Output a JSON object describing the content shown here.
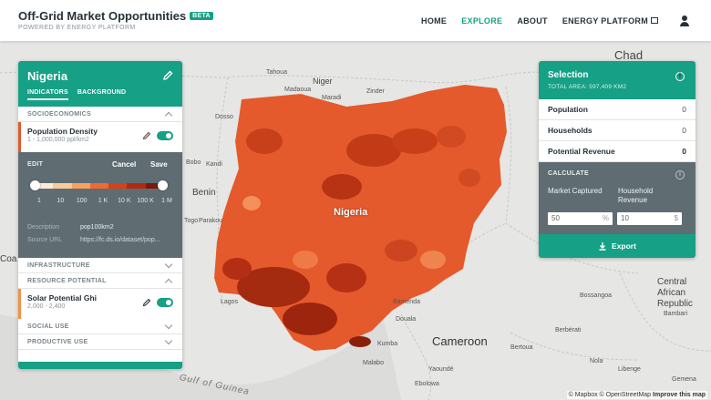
{
  "app": {
    "title": "Off-Grid Market Opportunities",
    "badge": "BETA",
    "subtitle": "POWERED BY ENERGY PLATFORM"
  },
  "nav": {
    "home": "HOME",
    "explore": "EXPLORE",
    "about": "ABOUT",
    "energy_platform": "ENERGY PLATFORM"
  },
  "panel": {
    "title": "Nigeria",
    "tabs": [
      "INDICATORS",
      "BACKGROUND"
    ],
    "sections": {
      "socioeconomics": "SOCIOECONOMICS",
      "infrastructure": "INFRASTRUCTURE",
      "resource_potential": "RESOURCE POTENTIAL",
      "social_use": "SOCIAL USE",
      "productive_use": "PRODUCTIVE USE"
    },
    "population": {
      "name": "Population Density",
      "range": "1 - 1,000,000 ppl/km2",
      "enabled": true,
      "edit_label": "EDIT",
      "cancel": "Cancel",
      "save": "Save",
      "ticks": [
        "1",
        "10",
        "100",
        "1 K",
        "10 K",
        "100 K",
        "1 M"
      ],
      "scale_colors": [
        "#fdebd6",
        "#fcc99a",
        "#f9a15e",
        "#ee6a30",
        "#d6401a",
        "#b02a12",
        "#7f170a"
      ],
      "description_label": "Description",
      "description": "pop100km2",
      "source_label": "Source URL",
      "source": "https://fc.ds.io/dataset/pop..."
    },
    "solar": {
      "name": "Solar Potential Ghi",
      "range": "2,000 - 2,400",
      "enabled": true
    }
  },
  "selection": {
    "title": "Selection",
    "total_area": "TOTAL AREA: 597,409 KM2",
    "rows": [
      {
        "label": "Population",
        "value": "0"
      },
      {
        "label": "Households",
        "value": "0"
      },
      {
        "label": "Potential Revenue",
        "value": "0"
      }
    ],
    "calculate": "CALCULATE",
    "market_label": "Market Captured",
    "market_value": "50",
    "market_unit": "%",
    "revenue_label": "Household Revenue",
    "revenue_value": "10",
    "revenue_unit": "$",
    "export": "Export"
  },
  "map": {
    "labels": {
      "chad": "Chad",
      "niger": "Niger",
      "benin": "Benin",
      "nigeria": "Nigeria",
      "cameroon": "Cameroon",
      "car": "Central African Republic",
      "togo": "Togo",
      "coast": "Coa",
      "gulf": "Gulf of Guinea",
      "tahoua": "Tahoua",
      "madaoua": "Madaoua",
      "maradi": "Maradi",
      "zinder": "Zinder",
      "dosso": "Dosso",
      "bobo": "Bobo",
      "kandi": "Kandi",
      "parakou": "Parakou",
      "lagos": "Lagos",
      "bamenda": "Bamenda",
      "douala": "Douala",
      "kumba": "Kumba",
      "yaounde": "Yaoundé",
      "malabo": "Malabo",
      "ebolowa": "Ebolowa",
      "bertoua": "Bertoua",
      "bossangoa": "Bossangoa",
      "bambari": "Bambari",
      "berberati": "Berbérati",
      "nola": "Nola",
      "libenge": "Libenge",
      "gemena": "Gemena"
    },
    "attribution": "© Mapbox © OpenStreetMap",
    "improve": "Improve this map"
  }
}
